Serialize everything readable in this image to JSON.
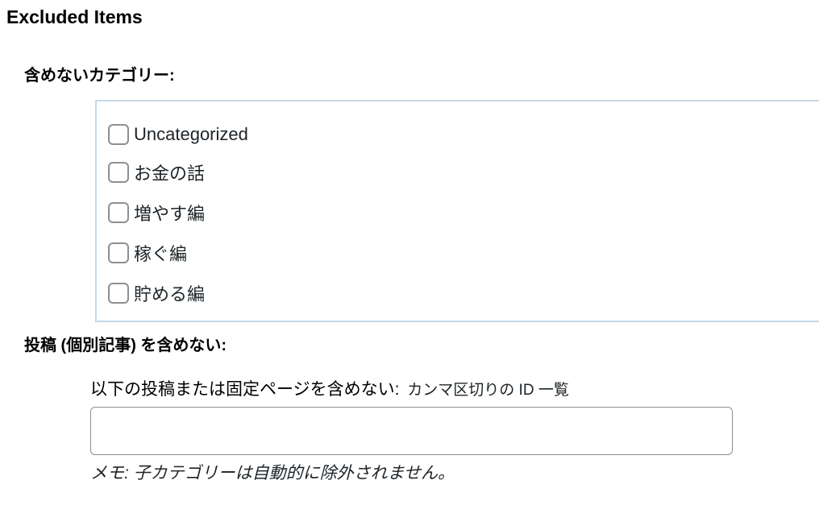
{
  "section": {
    "title": "Excluded Items"
  },
  "categories": {
    "label": "含めないカテゴリー:",
    "items": [
      {
        "label": "Uncategorized"
      },
      {
        "label": "お金の話"
      },
      {
        "label": "増やす編"
      },
      {
        "label": "稼ぐ編"
      },
      {
        "label": "貯める編"
      }
    ]
  },
  "posts": {
    "label": "投稿 (個別記事) を含めない:",
    "sublabel": "以下の投稿または固定ページを含めない:",
    "sublabel_note": "カンマ区切りの ID 一覧",
    "input_value": "",
    "note_prefix": "メモ:",
    "note_text": " 子カテゴリーは自動的に除外されません。"
  }
}
